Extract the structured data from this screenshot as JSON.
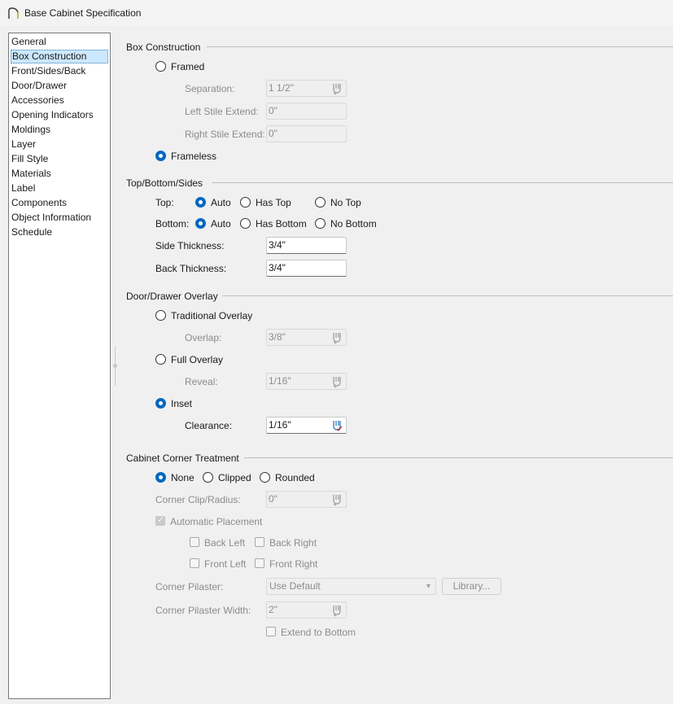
{
  "window": {
    "title": "Base Cabinet Specification"
  },
  "sidebar": {
    "items": [
      {
        "label": "General"
      },
      {
        "label": "Box Construction",
        "selected": true
      },
      {
        "label": "Front/Sides/Back"
      },
      {
        "label": "Door/Drawer"
      },
      {
        "label": "Accessories"
      },
      {
        "label": "Opening Indicators"
      },
      {
        "label": "Moldings"
      },
      {
        "label": "Layer"
      },
      {
        "label": "Fill Style"
      },
      {
        "label": "Materials"
      },
      {
        "label": "Label"
      },
      {
        "label": "Components"
      },
      {
        "label": "Object Information"
      },
      {
        "label": "Schedule"
      }
    ]
  },
  "box_construction": {
    "title": "Box Construction",
    "framed_label": "Framed",
    "separation_label": "Separation:",
    "separation_value": "1 1/2\"",
    "left_stile_label": "Left Stile Extend:",
    "left_stile_value": "0\"",
    "right_stile_label": "Right Stile Extend:",
    "right_stile_value": "0\"",
    "frameless_label": "Frameless",
    "selected": "Frameless"
  },
  "top_bottom_sides": {
    "title": "Top/Bottom/Sides",
    "top_label": "Top:",
    "top_auto": "Auto",
    "top_has": "Has Top",
    "top_no": "No Top",
    "bottom_label": "Bottom:",
    "bottom_auto": "Auto",
    "bottom_has": "Has Bottom",
    "bottom_no": "No Bottom",
    "side_thickness_label": "Side Thickness:",
    "side_thickness_value": "3/4\"",
    "back_thickness_label": "Back Thickness:",
    "back_thickness_value": "3/4\""
  },
  "overlay": {
    "title": "Door/Drawer Overlay",
    "traditional_label": "Traditional Overlay",
    "overlap_label": "Overlap:",
    "overlap_value": "3/8\"",
    "full_label": "Full Overlay",
    "reveal_label": "Reveal:",
    "reveal_value": "1/16\"",
    "inset_label": "Inset",
    "clearance_label": "Clearance:",
    "clearance_value": "1/16\"",
    "selected": "Inset"
  },
  "corner": {
    "title": "Cabinet Corner Treatment",
    "none_label": "None",
    "clipped_label": "Clipped",
    "rounded_label": "Rounded",
    "clip_radius_label": "Corner Clip/Radius:",
    "clip_radius_value": "0\"",
    "auto_placement_label": "Automatic Placement",
    "back_left_label": "Back Left",
    "back_right_label": "Back Right",
    "front_left_label": "Front Left",
    "front_right_label": "Front Right",
    "pilaster_label": "Corner Pilaster:",
    "pilaster_value": "Use Default",
    "library_label": "Library...",
    "pilaster_width_label": "Corner Pilaster Width:",
    "pilaster_width_value": "2\"",
    "extend_label": "Extend to Bottom"
  },
  "colors": {
    "accent": "#0067c0",
    "selection": "#cce8ff",
    "disabled_text": "#8c8c8c"
  }
}
